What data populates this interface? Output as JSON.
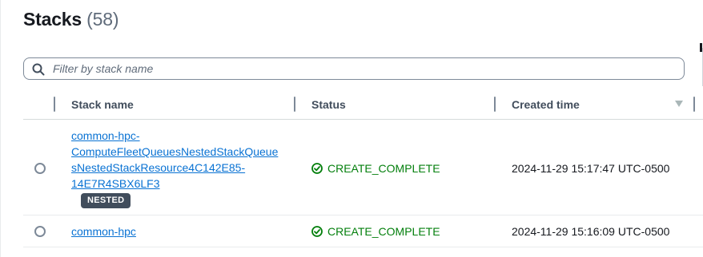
{
  "header": {
    "title": "Stacks",
    "count": "(58)"
  },
  "search": {
    "placeholder": "Filter by stack name",
    "value": ""
  },
  "table": {
    "columns": [
      {
        "label": "Stack name"
      },
      {
        "label": "Status"
      },
      {
        "label": "Created time",
        "sortable": true
      }
    ],
    "rows": [
      {
        "name_lines": [
          "common-hpc-",
          "ComputeFleetQueuesNestedStackQueue",
          "sNestedStackResource4C142E85-",
          "14E7R4SBX6LF3"
        ],
        "badge": "NESTED",
        "status": "CREATE_COMPLETE",
        "created": "2024-11-29 15:17:47 UTC-0500"
      },
      {
        "name_lines": [
          "common-hpc"
        ],
        "status": "CREATE_COMPLETE",
        "created": "2024-11-29 15:16:09 UTC-0500"
      }
    ]
  },
  "icons": {
    "search": "search-icon",
    "sort": "caret-down-icon",
    "status_ok": "check-circle-icon"
  },
  "colors": {
    "link": "#0972d3",
    "success": "#037f0c",
    "badge_bg": "#414d5c",
    "text": "#16191f"
  }
}
